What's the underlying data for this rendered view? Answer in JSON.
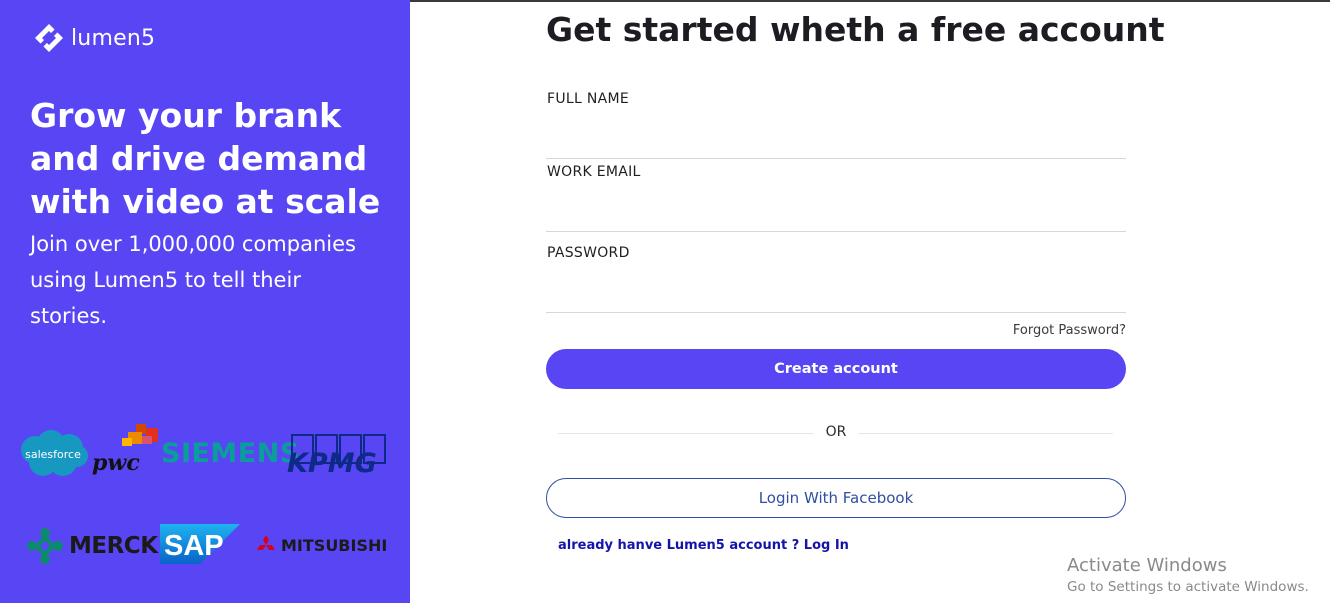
{
  "brand": {
    "name": "lumen5"
  },
  "hero": {
    "headline": "Grow your brank and drive demand with video at scale",
    "subline": "Join over 1,000,000 companies using Lumen5 to tell their stories."
  },
  "customer_logos": {
    "salesforce": "salesforce",
    "pwc": "pwc",
    "siemens": "SIEMENS",
    "kpmg": "KPMG",
    "merck": "MERCK",
    "sap": "SAP",
    "mitsubishi": "MITSUBISHI"
  },
  "form": {
    "title": "Get started wheth a free account",
    "full_name": {
      "label": "FULL NAME",
      "value": "",
      "placeholder": ""
    },
    "work_email": {
      "label": "WORK EMAIL",
      "value": "",
      "placeholder": ""
    },
    "password": {
      "label": "PASSWORD",
      "value": "",
      "placeholder": ""
    },
    "forgot_password": "Forgot Password?",
    "create_button": "Create account",
    "divider_text": "OR",
    "facebook_button": "Login With Facebook",
    "login_link": "already hanve Lumen5 account ? Log In"
  },
  "system_watermark": {
    "line1": "Activate Windows",
    "line2": "Go to Settings to activate Windows."
  },
  "colors": {
    "accent": "#5846f5",
    "facebook_border": "#2f4fa0",
    "link": "#1414a8"
  }
}
